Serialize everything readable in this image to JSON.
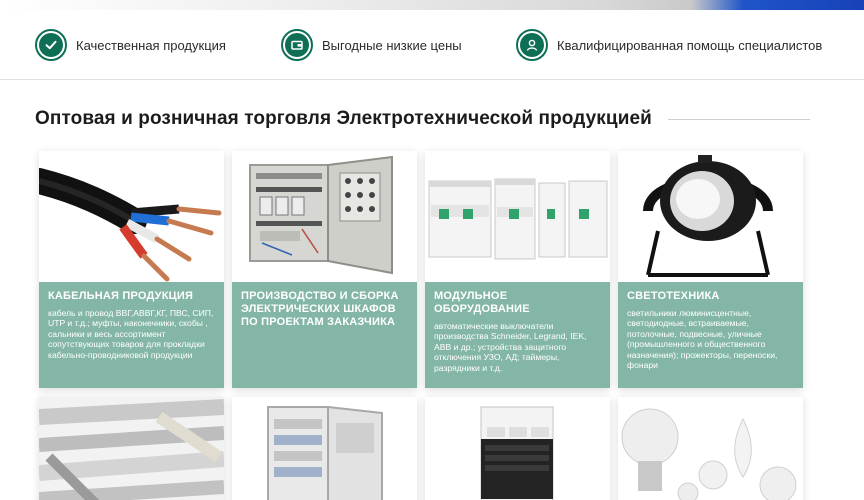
{
  "features": [
    {
      "label": "Качественная продукция",
      "icon": "check-icon"
    },
    {
      "label": "Выгодные низкие цены",
      "icon": "wallet-icon"
    },
    {
      "label": "Квалифицированная помощь специалистов",
      "icon": "person-icon"
    }
  ],
  "section": {
    "title": "Оптовая и розничная торговля Электротехнической продукцией"
  },
  "categories": [
    {
      "title": "КАБЕЛЬНАЯ ПРОДУКЦИЯ",
      "description": "кабель и провод ВВГ,АВВГ,КГ, ПВС, СИП, UTP и т.д.; муфты, наконечники, скобы , сальники и весь ассортимент сопутствующих товаров для прокладки кабельно-проводниковой продукции"
    },
    {
      "title": "ПРОИЗВОДСТВО И СБОРКА ЭЛЕКТРИЧЕСКИХ ШКАФОВ ПО ПРОЕКТАМ ЗАКАЗЧИКА",
      "description": ""
    },
    {
      "title": "МОДУЛЬНОЕ ОБОРУДОВАНИЕ",
      "description": "автоматические выключатели производства Schneider, Legrand, IEK, ABB и др.; устройства защитного отключения УЗО, АД; таймеры, разрядники и т.д."
    },
    {
      "title": "СВЕТОТЕХНИКА",
      "description": "светильники люминисцентные, светодиодные, встраиваемые, потолочные, подвесные, уличные (промышленного и общественного назначения); прожекторы, переноски, фонари"
    }
  ],
  "colors": {
    "accent": "#0f6e56",
    "card_info": "#83b6a6",
    "brand_blue": "#1f55c9"
  }
}
